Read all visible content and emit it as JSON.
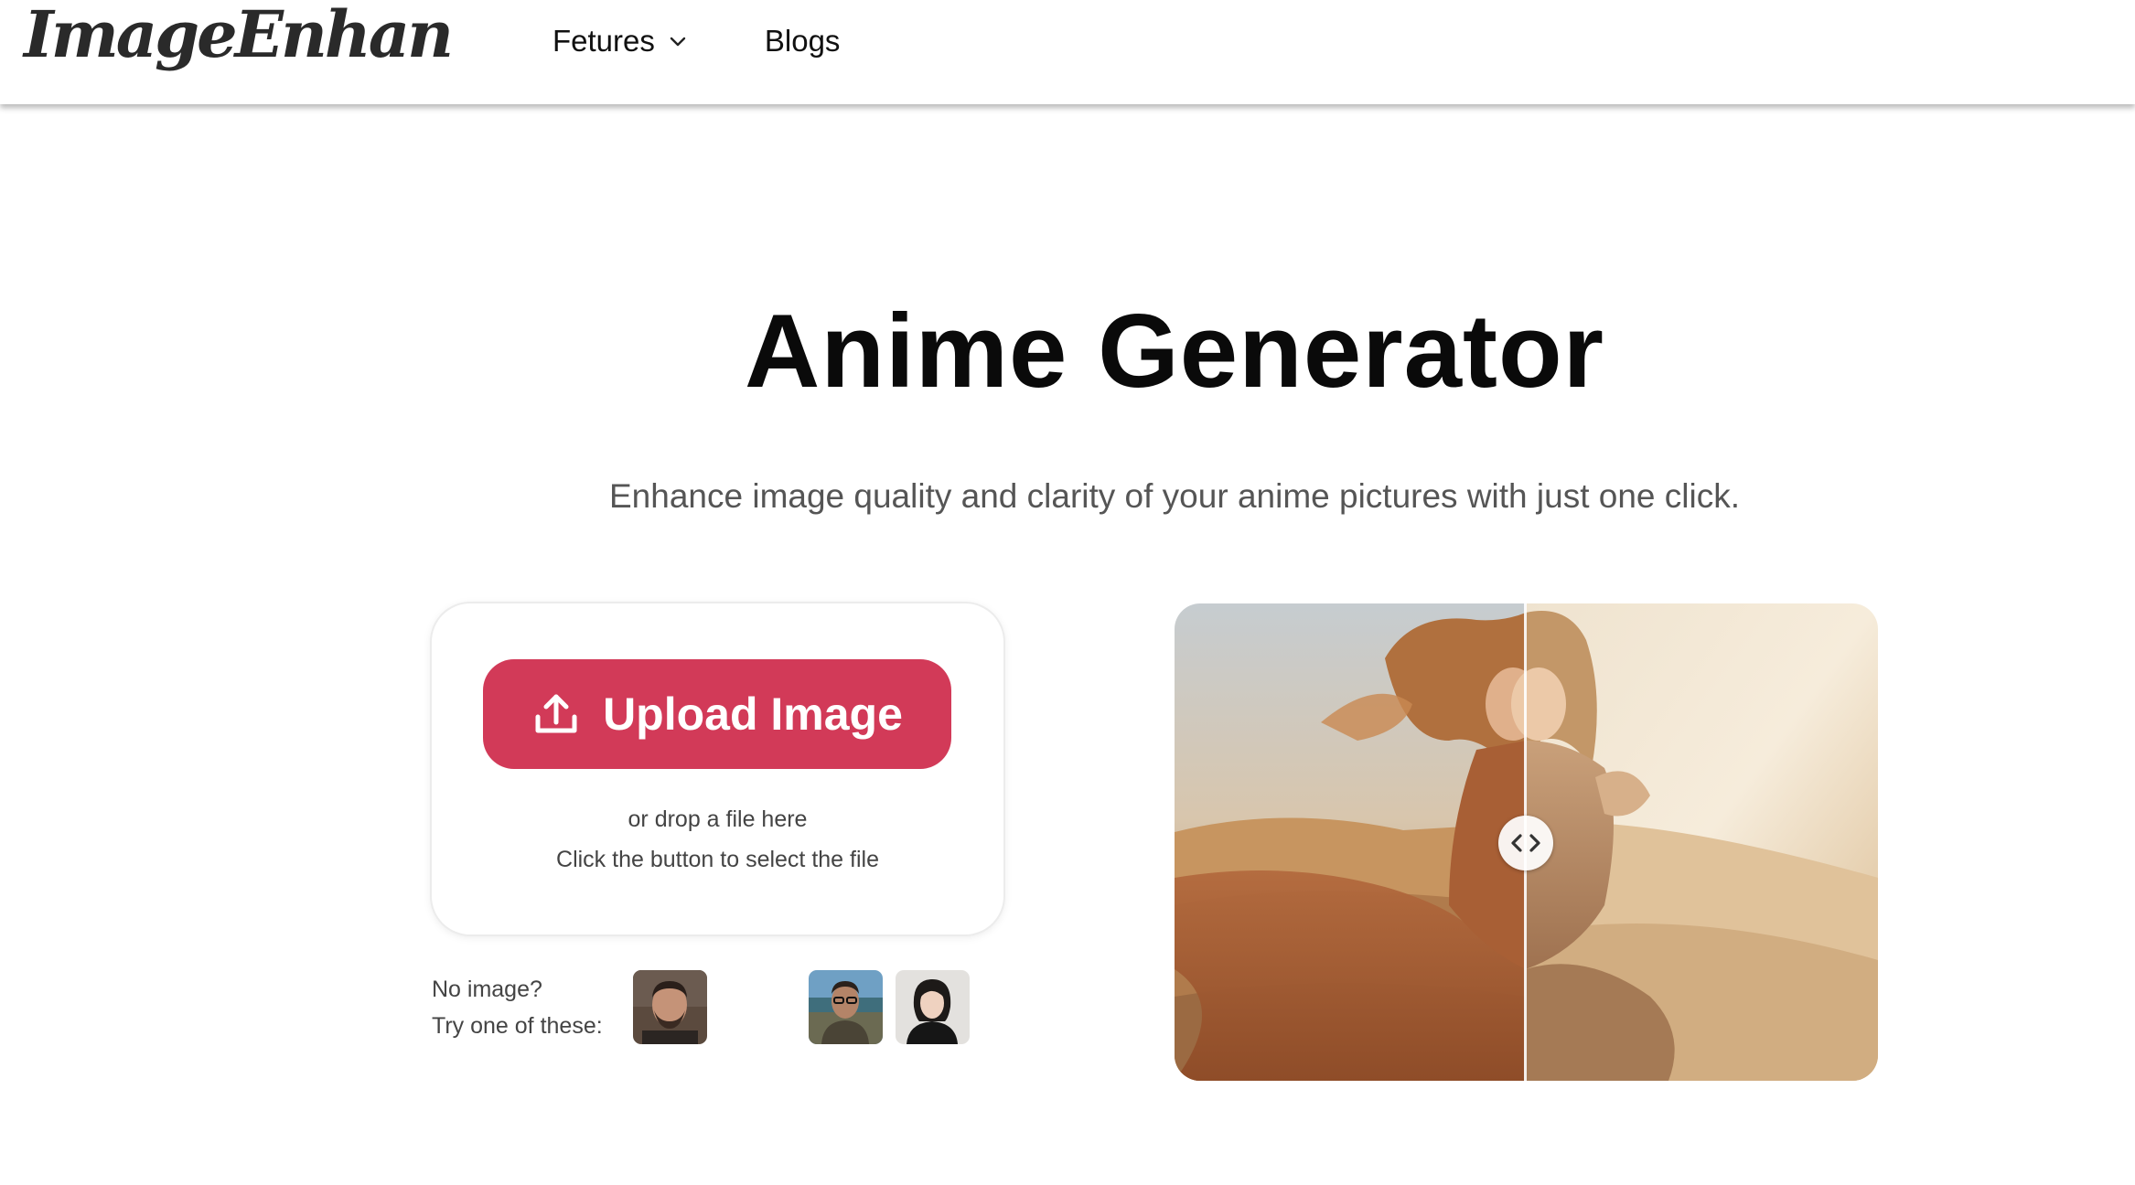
{
  "header": {
    "logo_text": "ImageEnhan",
    "nav": [
      {
        "label": "Fetures",
        "has_dropdown": true
      },
      {
        "label": "Blogs",
        "has_dropdown": false
      }
    ]
  },
  "hero": {
    "title": "Anime Generator",
    "subtitle": "Enhance image quality and clarity of your anime pictures with just one click."
  },
  "upload": {
    "button_label": "Upload Image",
    "button_icon": "upload-icon",
    "drop_hint": "or drop a file here",
    "click_hint": "Click the button to select the file",
    "accent_color": "#d23a58"
  },
  "samples": {
    "line1": "No image?",
    "line2": "Try one of these:",
    "thumbnails": [
      "man-with-beard",
      "man-with-glasses-outdoors",
      "woman-portrait"
    ]
  },
  "compare": {
    "handle_icon": "left-right-arrows-icon",
    "divider_position": 0.5
  }
}
